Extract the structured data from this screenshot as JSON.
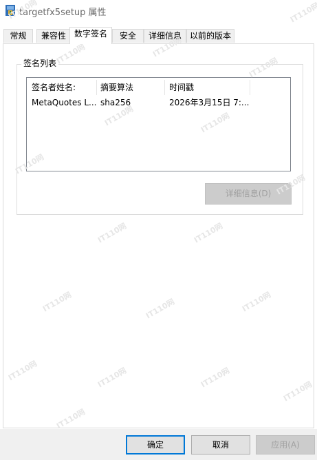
{
  "window": {
    "title": "targetfx5setup 属性",
    "icon": "installer-package-icon"
  },
  "tabs": [
    {
      "label": "常规"
    },
    {
      "label": "兼容性"
    },
    {
      "label": "数字签名",
      "active": true
    },
    {
      "label": "安全"
    },
    {
      "label": "详细信息"
    },
    {
      "label": "以前的版本"
    }
  ],
  "signature_group": {
    "title": "签名列表",
    "columns": [
      "签名者姓名:",
      "摘要算法",
      "时间戳"
    ],
    "rows": [
      {
        "signer": "MetaQuotes L...",
        "algorithm": "sha256",
        "timestamp": "2026年3月15日 7:..."
      }
    ],
    "details_button": "详细信息(D)"
  },
  "footer": {
    "ok": "确定",
    "cancel": "取消",
    "apply": "应用(A)"
  },
  "watermark": {
    "text": "IT110网"
  },
  "colors": {
    "tab_border": "#d9d9d9",
    "disabled_text": "#a0a0a0",
    "focus_blue": "#0078d7"
  }
}
